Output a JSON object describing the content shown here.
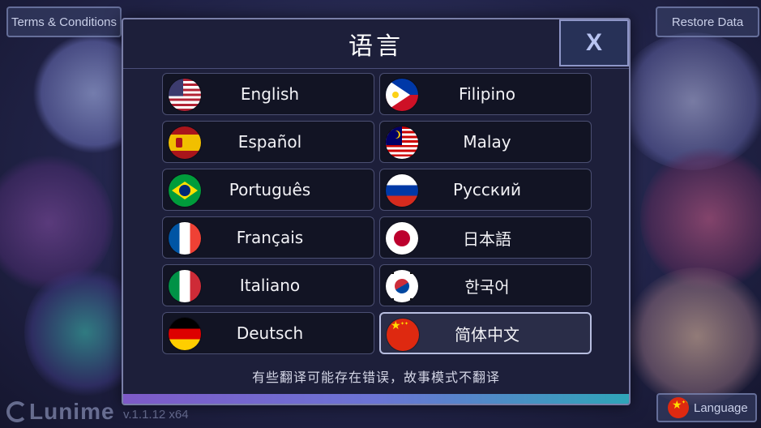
{
  "header": {
    "terms_label": "Terms & Conditions",
    "restore_label": "Restore Data"
  },
  "footer": {
    "logo_text": "Lunime",
    "version": "v.1.1.12 x64",
    "language_button_label": "Language"
  },
  "dialog": {
    "title": "语言",
    "close_label": "X",
    "note": "有些翻译可能存在错误，故事模式不翻译",
    "selected_language": "简体中文",
    "languages": [
      {
        "label": "English",
        "flag": "us-flag-icon"
      },
      {
        "label": "Filipino",
        "flag": "philippines-flag-icon"
      },
      {
        "label": "Español",
        "flag": "spain-flag-icon"
      },
      {
        "label": "Malay",
        "flag": "malaysia-flag-icon"
      },
      {
        "label": "Português",
        "flag": "brazil-flag-icon"
      },
      {
        "label": "Русский",
        "flag": "russia-flag-icon"
      },
      {
        "label": "Français",
        "flag": "france-flag-icon"
      },
      {
        "label": "日本語",
        "flag": "japan-flag-icon"
      },
      {
        "label": "Italiano",
        "flag": "italy-flag-icon"
      },
      {
        "label": "한국어",
        "flag": "korea-flag-icon"
      },
      {
        "label": "Deutsch",
        "flag": "germany-flag-icon"
      },
      {
        "label": "简体中文",
        "flag": "china-flag-icon"
      }
    ]
  },
  "colors": {
    "dialog_bg": "#1d1f3a",
    "option_bg": "#121424",
    "selected_option_bg": "#2a2d48",
    "close_button_bg": "#273157",
    "accent_bar_start": "#7e5ac8",
    "accent_bar_end": "#2fa5b8"
  }
}
